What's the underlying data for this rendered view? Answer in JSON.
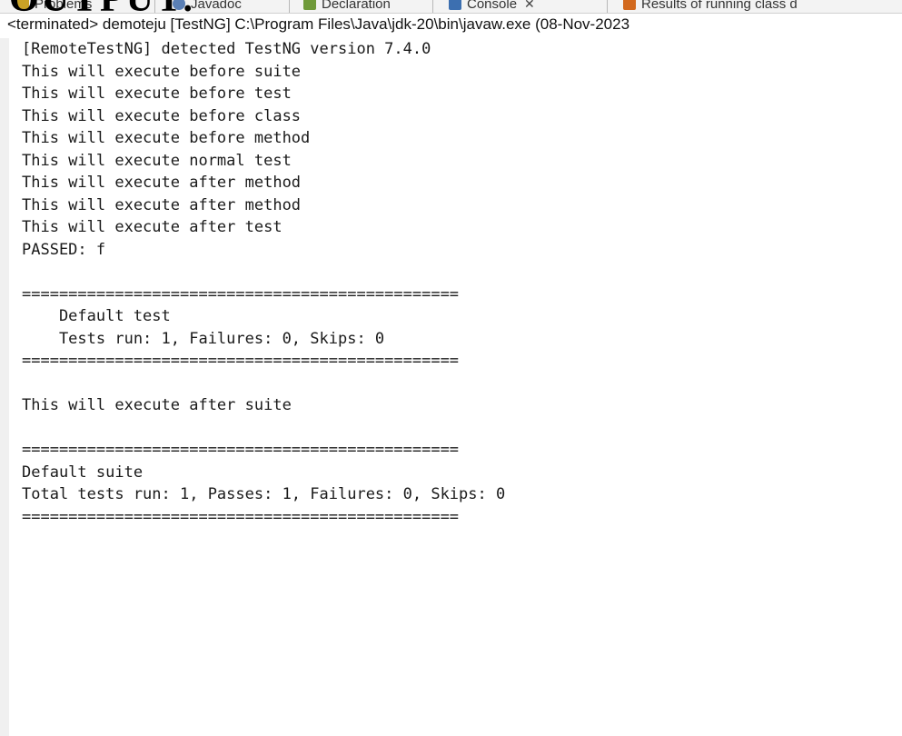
{
  "heading": "OUTPUT:",
  "tabs": [
    {
      "label": "Problems",
      "icon": "problems-icon",
      "color": "#c9a227"
    },
    {
      "label": "Javadoc",
      "icon": "javadoc-icon",
      "color": "#5a7fb5"
    },
    {
      "label": "Declaration",
      "icon": "declaration-icon",
      "color": "#6f9a3a"
    },
    {
      "label": "Console",
      "icon": "console-icon",
      "color": "#3c6fb0",
      "close": "✕"
    },
    {
      "label": "Results of running class d",
      "icon": "testng-results-icon",
      "color": "#d2691e"
    }
  ],
  "status_line": "<terminated> demoteju [TestNG] C:\\Program Files\\Java\\jdk-20\\bin\\javaw.exe  (08-Nov-2023",
  "console_lines": [
    "[RemoteTestNG] detected TestNG version 7.4.0",
    "This will execute before suite",
    "This will execute before test",
    "This will execute before class",
    "This will execute before method",
    "This will execute normal test",
    "This will execute after method",
    "This will execute after method",
    "This will execute after test",
    "PASSED: f",
    "",
    "===============================================",
    "    Default test",
    "    Tests run: 1, Failures: 0, Skips: 0",
    "===============================================",
    "",
    "This will execute after suite",
    "",
    "===============================================",
    "Default suite",
    "Total tests run: 1, Passes: 1, Failures: 0, Skips: 0",
    "==============================================="
  ]
}
